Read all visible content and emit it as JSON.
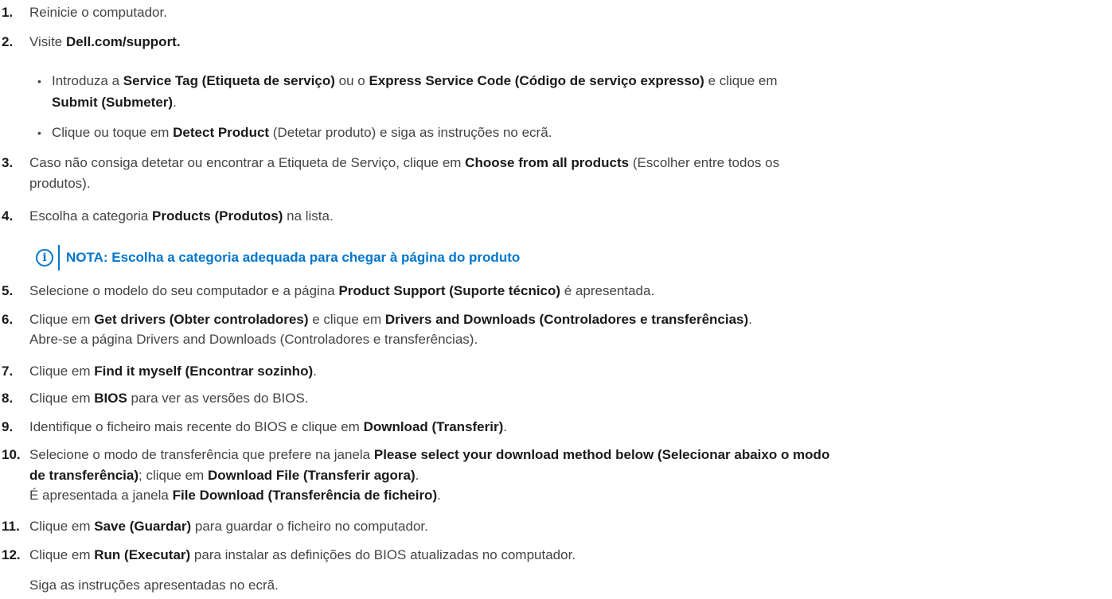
{
  "steps": {
    "s1": {
      "num": "1.",
      "text": "Reinicie o computador."
    },
    "s2": {
      "num": "2.",
      "a": "Visite ",
      "b": "Dell.com/support."
    },
    "s2b1": {
      "a": "Introduza a ",
      "b": "Service Tag (Etiqueta de serviço)",
      "c": " ou o ",
      "d": "Express Service Code (Código de serviço expresso)",
      "e": " e clique em",
      "f": "Submit (Submeter)",
      "g": "."
    },
    "s2b2": {
      "a": "Clique ou toque em ",
      "b": "Detect Product",
      "c": " (Detetar produto) e siga as instruções no ecrã."
    },
    "s3": {
      "num": "3.",
      "a": "Caso não consiga detetar ou encontrar a Etiqueta de Serviço, clique em ",
      "b": "Choose from all products",
      "c": " (Escolher entre todos os",
      "d": "produtos)."
    },
    "s4": {
      "num": "4.",
      "a": "Escolha a categoria ",
      "b": "Products (Produtos)",
      "c": " na lista."
    },
    "note": {
      "icon": "i",
      "text": "NOTA: Escolha a categoria adequada para chegar à página do produto"
    },
    "s5": {
      "num": "5.",
      "a": "Selecione o modelo do seu computador e a página ",
      "b": "Product Support (Suporte técnico)",
      "c": " é apresentada."
    },
    "s6": {
      "num": "6.",
      "a": "Clique em ",
      "b": "Get drivers (Obter controladores)",
      "c": " e clique em ",
      "d": "Drivers and Downloads (Controladores e transferências)",
      "e": ".",
      "f": "Abre-se a página Drivers and Downloads (Controladores e transferências)."
    },
    "s7": {
      "num": "7.",
      "a": "Clique em ",
      "b": "Find it myself (Encontrar sozinho)",
      "c": "."
    },
    "s8": {
      "num": "8.",
      "a": "Clique em ",
      "b": "BIOS",
      "c": " para ver as versões do BIOS."
    },
    "s9": {
      "num": "9.",
      "a": "Identifique o ficheiro mais recente do BIOS e clique em ",
      "b": "Download (Transferir)",
      "c": "."
    },
    "s10": {
      "num": "10.",
      "a": "Selecione o modo de transferência que prefere na janela ",
      "b": "Please select your download method below (Selecionar abaixo o modo",
      "c": "de transferência)",
      "d": "; clique em ",
      "e": "Download File (Transferir agora)",
      "f": ".",
      "g": "É apresentada a janela ",
      "h": "File Download (Transferência de ficheiro)",
      "i": "."
    },
    "s11": {
      "num": "11.",
      "a": "Clique em ",
      "b": "Save (Guardar)",
      "c": " para guardar o ficheiro no computador."
    },
    "s12": {
      "num": "12.",
      "a": "Clique em ",
      "b": "Run (Executar)",
      "c": " para instalar as definições do BIOS atualizadas no computador.",
      "d": "Siga as instruções apresentadas no ecrã."
    }
  }
}
